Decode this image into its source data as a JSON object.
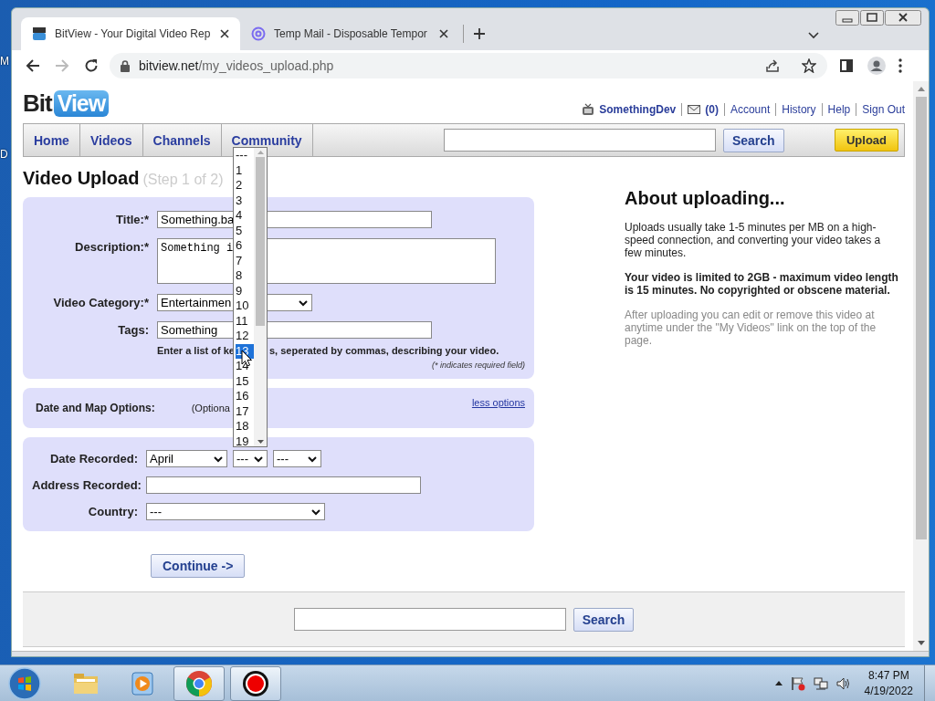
{
  "desktop_labels": [
    "M",
    "D"
  ],
  "browser": {
    "tabs": [
      {
        "title": "BitView - Your Digital Video Rep",
        "kind": "bitview",
        "selected": true
      },
      {
        "title": "Temp Mail - Disposable Tempor",
        "kind": "mail",
        "selected": false
      }
    ],
    "url": {
      "host": "bitview.net",
      "path": "/my_videos_upload.php"
    },
    "forward_disabled": true
  },
  "site": {
    "logo": {
      "plain": "Bit",
      "boxed": "View"
    },
    "user_bar": {
      "username": "SomethingDev",
      "messages": "(0)",
      "links": [
        "Account",
        "History",
        "Help",
        "Sign Out"
      ]
    },
    "nav": {
      "items": [
        "Home",
        "Videos",
        "Channels",
        "Community"
      ],
      "search_button": "Search",
      "upload_button": "Upload"
    },
    "heading": "Video Upload",
    "step": "(Step 1 of 2)",
    "form": {
      "rows": [
        {
          "kind": "input",
          "label": "Title:*",
          "value": "Something.ba"
        },
        {
          "kind": "textarea",
          "label": "Description:*",
          "value": "Something i"
        },
        {
          "kind": "select",
          "label": "Video Category:*",
          "value": "Entertainmen"
        },
        {
          "kind": "input",
          "label": "Tags:",
          "value": "Something"
        }
      ],
      "hint_start": "Enter a list of ke",
      "hint_end": "s, seperated by commas, describing your video.",
      "required_note": "(* indicates required field)"
    },
    "options": {
      "label": "Date and Map Options:",
      "note": "(Optiona",
      "link": "less options"
    },
    "date_panel": {
      "date_label": "Date Recorded:",
      "month": "April",
      "day": "---",
      "year": "---",
      "address_label": "Address Recorded:",
      "country_label": "Country:",
      "country": "---"
    },
    "continue_button": "Continue ->",
    "about": {
      "title": "About uploading...",
      "paragraphs": [
        {
          "kind": "normal",
          "text": "Uploads usually take 1-5 minutes per MB on a high-speed connection, and converting your video takes a few minutes."
        },
        {
          "kind": "bold",
          "text": "Your video is limited to 2GB - maximum video length is 15 minutes. No copyrighted or obscene material."
        },
        {
          "kind": "muted",
          "text": "After uploading you can edit or remove this video at anytime under the \"My Videos\" link on the top of the page."
        }
      ]
    },
    "footer": {
      "search_button": "Search"
    },
    "day_dropdown": {
      "options": [
        {
          "label": "---",
          "selected": false
        },
        {
          "label": "1",
          "selected": false
        },
        {
          "label": "2",
          "selected": false
        },
        {
          "label": "3",
          "selected": false
        },
        {
          "label": "4",
          "selected": false
        },
        {
          "label": "5",
          "selected": false
        },
        {
          "label": "6",
          "selected": false
        },
        {
          "label": "7",
          "selected": false
        },
        {
          "label": "8",
          "selected": false
        },
        {
          "label": "9",
          "selected": false
        },
        {
          "label": "10",
          "selected": false
        },
        {
          "label": "11",
          "selected": false
        },
        {
          "label": "12",
          "selected": false
        },
        {
          "label": "13",
          "selected": true
        },
        {
          "label": "14",
          "selected": false
        },
        {
          "label": "15",
          "selected": false
        },
        {
          "label": "16",
          "selected": false
        },
        {
          "label": "17",
          "selected": false
        },
        {
          "label": "18",
          "selected": false
        },
        {
          "label": "19",
          "selected": false
        }
      ]
    }
  },
  "taskbar": {
    "apps": [
      {
        "kind": "folder",
        "running": false
      },
      {
        "kind": "media",
        "running": false
      },
      {
        "kind": "chrome",
        "running": true
      },
      {
        "kind": "record",
        "running": true
      }
    ],
    "time": "8:47 PM",
    "date": "4/19/2022"
  }
}
